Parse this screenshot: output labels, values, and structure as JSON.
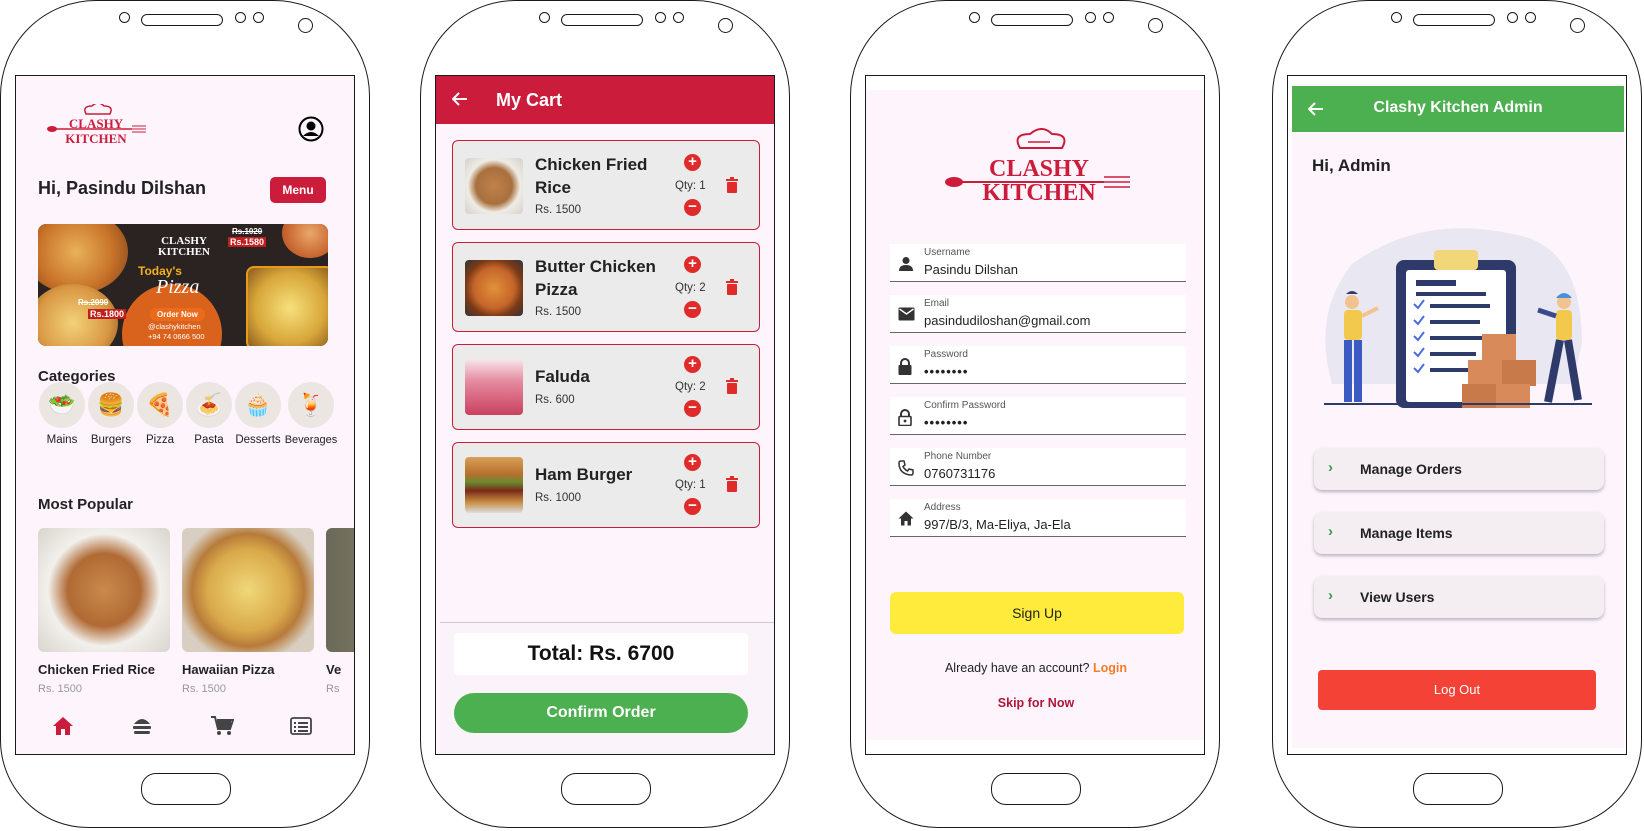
{
  "screen1": {
    "logo_line1": "CLASHY",
    "logo_line2": "KITCHEN",
    "greeting": "Hi, Pasindu Dilshan",
    "menu_button": "Menu",
    "banner": {
      "logo_line1": "CLASHY",
      "logo_line2": "KITCHEN",
      "todays": "Today's",
      "pizza": "Pizza",
      "old_price1": "Rs.1020",
      "new_price1": "Rs.1580",
      "old_price2": "Rs.2090",
      "new_price2": "Rs.1800",
      "cta": "Order Now",
      "handle": "@clashykitchen",
      "phone": "+94 74 0666 500"
    },
    "categories_title": "Categories",
    "categories": [
      {
        "label": "Mains",
        "icon": "🥗"
      },
      {
        "label": "Burgers",
        "icon": "🍔"
      },
      {
        "label": "Pizza",
        "icon": "🍕"
      },
      {
        "label": "Pasta",
        "icon": "🍝"
      },
      {
        "label": "Desserts",
        "icon": "🧁"
      },
      {
        "label": "Beverages",
        "icon": "🍹"
      }
    ],
    "popular_title": "Most Popular",
    "popular": [
      {
        "name": "Chicken Fried Rice",
        "price": "Rs. 1500"
      },
      {
        "name": "Hawaiian Pizza",
        "price": "Rs. 1500"
      },
      {
        "name": "Ve",
        "price": "Rs"
      }
    ],
    "nav": [
      "home-icon",
      "burger-icon",
      "cart-icon",
      "list-icon"
    ],
    "accent": "#cc1c3c"
  },
  "screen2": {
    "title": "My Cart",
    "items": [
      {
        "name1": "Chicken Fried",
        "name2": "Rice",
        "price": "Rs. 1500",
        "qty": "Qty: 1"
      },
      {
        "name1": "Butter Chicken",
        "name2": "Pizza",
        "price": "Rs. 1500",
        "qty": "Qty: 2"
      },
      {
        "name1": "Faluda",
        "name2": "",
        "price": "Rs. 600",
        "qty": "Qty: 2"
      },
      {
        "name1": "Ham Burger",
        "name2": "",
        "price": "Rs. 1000",
        "qty": "Qty: 1"
      }
    ],
    "total": "Total: Rs. 6700",
    "confirm": "Confirm Order",
    "green": "#4caf50"
  },
  "screen3": {
    "logo_line1": "CLASHY",
    "logo_line2": "KITCHEN",
    "fields": [
      {
        "label": "Username",
        "value": "Pasindu Dilshan",
        "icon": "person-icon"
      },
      {
        "label": "Email",
        "value": "pasindudiloshan@gmail.com",
        "icon": "mail-icon"
      },
      {
        "label": "Password",
        "value": "••••••••",
        "icon": "lock-icon"
      },
      {
        "label": "Confirm Password",
        "value": "••••••••",
        "icon": "lock-open-icon"
      },
      {
        "label": "Phone Number",
        "value": "0760731176",
        "icon": "phone-icon"
      },
      {
        "label": "Address",
        "value": "997/B/3, Ma-Eliya, Ja-Ela",
        "icon": "home-icon"
      }
    ],
    "signup": "Sign Up",
    "already": "Already have an account?",
    "login": "Login",
    "skip": "Skip for Now",
    "yellow": "#ffeb3b"
  },
  "screen4": {
    "title": "Clashy Kitchen Admin",
    "greeting": "Hi, Admin",
    "tiles": [
      "Manage Orders",
      "Manage Items",
      "View Users"
    ],
    "logout": "Log Out",
    "red": "#f44336"
  }
}
